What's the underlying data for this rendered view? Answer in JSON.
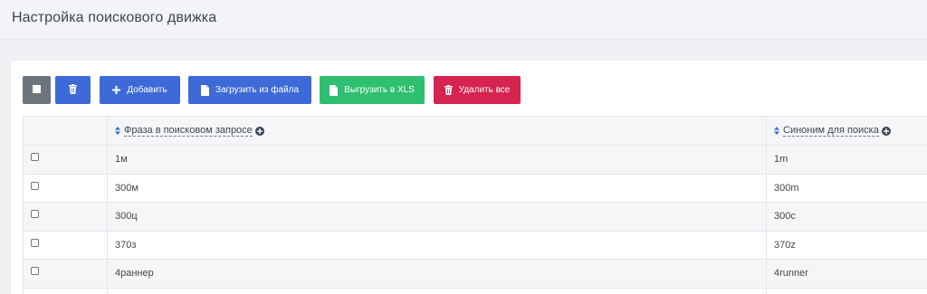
{
  "header": {
    "title": "Настройка поискового движка"
  },
  "toolbar": {
    "select_all_icon": "square-icon",
    "trash_icon": "trash-icon",
    "add_label": "Добавить",
    "upload_label": "Загрузить из файла",
    "export_label": "Выгрузить в XLS",
    "delete_all_label": "Удалить все"
  },
  "colors": {
    "primary": "#3d6ad6",
    "secondary": "#6c757d",
    "success": "#2fbf71",
    "danger": "#d6234f"
  },
  "table": {
    "columns": [
      {
        "label": "Фраза в поисковом запросе"
      },
      {
        "label": "Синоним для поиска"
      }
    ],
    "rows": [
      {
        "phrase": "1м",
        "synonym": "1m"
      },
      {
        "phrase": "300м",
        "synonym": "300m"
      },
      {
        "phrase": "300ц",
        "synonym": "300c"
      },
      {
        "phrase": "370з",
        "synonym": "370z"
      },
      {
        "phrase": "4раннер",
        "synonym": "4runner"
      }
    ]
  }
}
